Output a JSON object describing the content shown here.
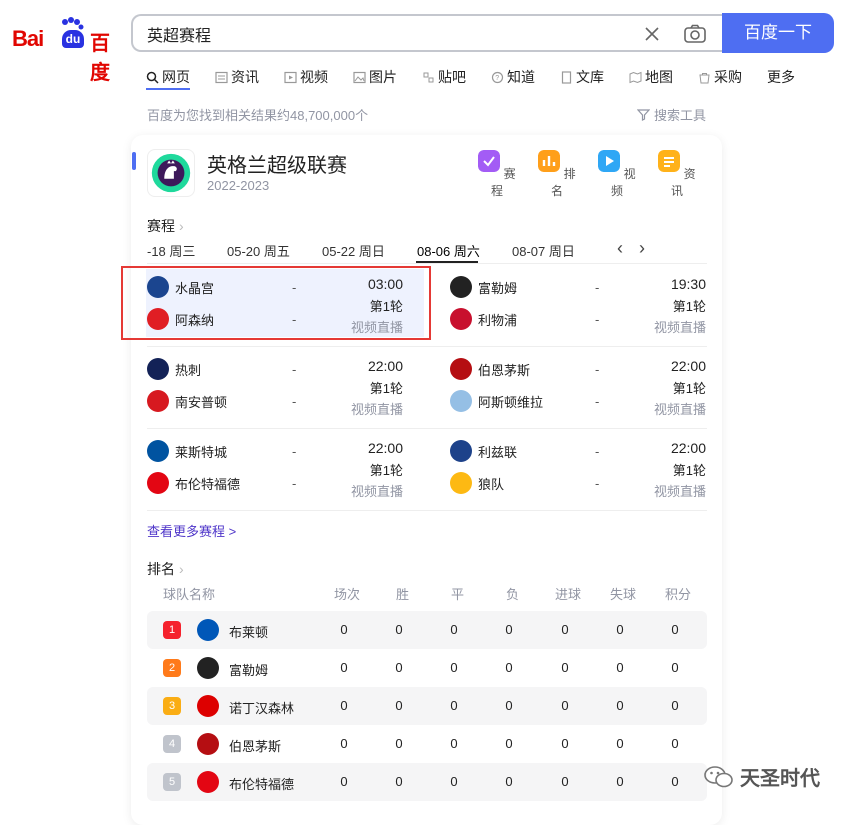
{
  "brand": {
    "bai": "Bai",
    "du": "du",
    "cn": "百度"
  },
  "search": {
    "query": "英超赛程",
    "button": "百度一下"
  },
  "tabs": [
    "网页",
    "资讯",
    "视频",
    "图片",
    "贴吧",
    "知道",
    "文库",
    "地图",
    "采购",
    "更多"
  ],
  "result_count": "百度为您找到相关结果约48,700,000个",
  "tools_label": "搜索工具",
  "card": {
    "title": "英格兰超级联赛",
    "season": "2022-2023",
    "quick_links": [
      {
        "label": "赛程",
        "icon": "calendar-check-icon",
        "color": "#a35cf5"
      },
      {
        "label": "排名",
        "icon": "bar-chart-icon",
        "color": "#ff9f1a"
      },
      {
        "label": "视频",
        "icon": "play-icon",
        "color": "#2fa7f5"
      },
      {
        "label": "资讯",
        "icon": "news-icon",
        "color": "#ffb21a"
      }
    ],
    "schedule_title": "赛程",
    "dates": [
      "-18 周三",
      "05-20 周五",
      "05-22 周日",
      "08-06 周六",
      "08-07 周日"
    ],
    "active_date": "08-06 周六",
    "matches": [
      {
        "home": "水晶宫",
        "away": "阿森纳",
        "home_color": "#1b458f",
        "away_color": "#e01e24",
        "time": "03:00",
        "round": "第1轮",
        "live": "视频直播"
      },
      {
        "home": "富勒姆",
        "away": "利物浦",
        "home_color": "#222222",
        "away_color": "#c8102e",
        "time": "19:30",
        "round": "第1轮",
        "live": "视频直播"
      },
      {
        "home": "热刺",
        "away": "南安普顿",
        "home_color": "#132257",
        "away_color": "#d71920",
        "time": "22:00",
        "round": "第1轮",
        "live": "视频直播"
      },
      {
        "home": "伯恩茅斯",
        "away": "阿斯顿维拉",
        "home_color": "#b50e12",
        "away_color": "#95bfe5",
        "time": "22:00",
        "round": "第1轮",
        "live": "视频直播"
      },
      {
        "home": "莱斯特城",
        "away": "布伦特福德",
        "home_color": "#0053a0",
        "away_color": "#e30613",
        "time": "22:00",
        "round": "第1轮",
        "live": "视频直播"
      },
      {
        "home": "利兹联",
        "away": "狼队",
        "home_color": "#1d428a",
        "away_color": "#fdb913",
        "time": "22:00",
        "round": "第1轮",
        "live": "视频直播"
      }
    ],
    "dash": "-",
    "more_link": "查看更多赛程 >",
    "ranking_title": "排名",
    "ranking_headers": [
      "球队名称",
      "场次",
      "胜",
      "平",
      "负",
      "进球",
      "失球",
      "积分"
    ],
    "ranking": [
      {
        "rank": "1",
        "team": "布莱顿",
        "rank_color": "#f5222d",
        "crest_color": "#0057b8",
        "values": [
          "0",
          "0",
          "0",
          "0",
          "0",
          "0",
          "0"
        ]
      },
      {
        "rank": "2",
        "team": "富勒姆",
        "rank_color": "#ff7a1a",
        "crest_color": "#222222",
        "values": [
          "0",
          "0",
          "0",
          "0",
          "0",
          "0",
          "0"
        ]
      },
      {
        "rank": "3",
        "team": "诺丁汉森林",
        "rank_color": "#faad14",
        "crest_color": "#dd0000",
        "values": [
          "0",
          "0",
          "0",
          "0",
          "0",
          "0",
          "0"
        ]
      },
      {
        "rank": "4",
        "team": "伯恩茅斯",
        "rank_color": "#c0c4cc",
        "crest_color": "#b50e12",
        "values": [
          "0",
          "0",
          "0",
          "0",
          "0",
          "0",
          "0"
        ]
      },
      {
        "rank": "5",
        "team": "布伦特福德",
        "rank_color": "#c0c4cc",
        "crest_color": "#e30613",
        "values": [
          "0",
          "0",
          "0",
          "0",
          "0",
          "0",
          "0"
        ]
      }
    ]
  },
  "watermark": "天圣时代",
  "colors": {
    "accent": "#4e6ef2",
    "highlight_border": "#e53935"
  }
}
